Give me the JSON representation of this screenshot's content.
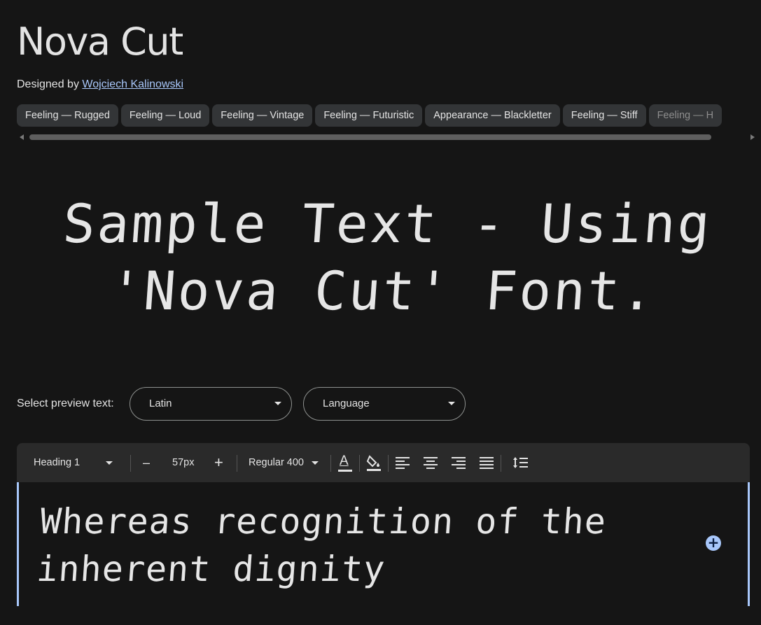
{
  "header": {
    "family_name": "Nova Cut",
    "designed_by_label": "Designed by",
    "designer_name": "Wojciech Kalinowski"
  },
  "tags": [
    "Feeling — Rugged",
    "Feeling — Loud",
    "Feeling — Vintage",
    "Feeling — Futuristic",
    "Appearance — Blackletter",
    "Feeling — Stiff",
    "Feeling — H"
  ],
  "sample_text": "Sample Text - Using 'Nova Cut' Font.",
  "preview": {
    "label": "Select preview text:",
    "script_value": "Latin",
    "language_value": "Language"
  },
  "toolbar": {
    "style_value": "Heading 1",
    "decrease_label": "–",
    "size_value": "57px",
    "increase_label": "+",
    "weight_value": "Regular 400",
    "text_color_glyph": "A"
  },
  "editor": {
    "text": "Whereas recognition of the inherent dignity",
    "add_label": "+"
  },
  "colors": {
    "background": "#151515",
    "chip_bg": "#333537",
    "toolbar_bg": "#2a2a2a",
    "accent": "#a8c7fa"
  }
}
